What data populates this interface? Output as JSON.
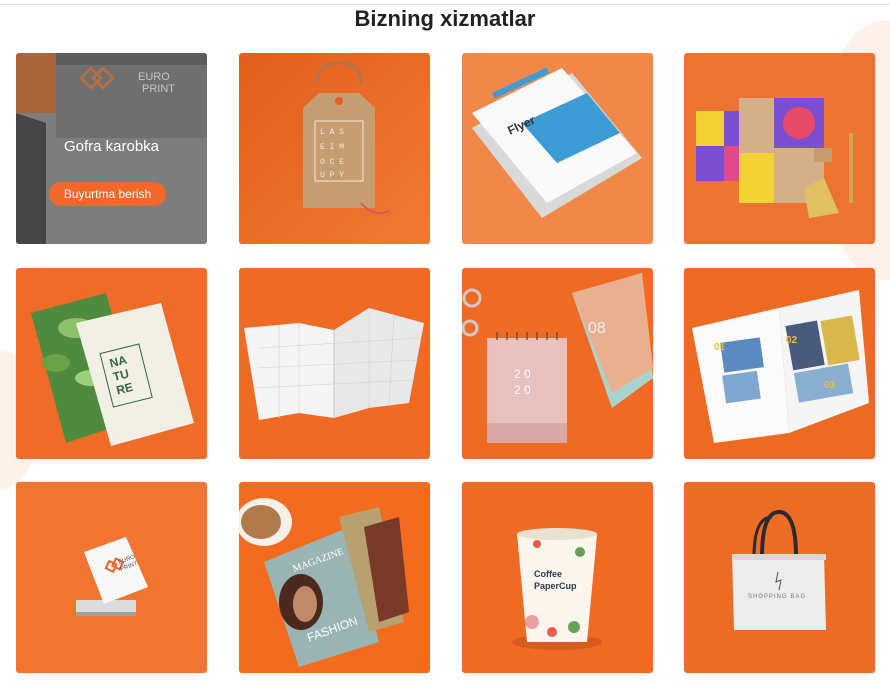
{
  "section": {
    "title": "Bizning xizmatlar"
  },
  "cards": [
    {
      "name": "Gofra karobka",
      "button_label": "Buyurtma berish",
      "logo_text": [
        "EURO",
        "PRINT"
      ]
    },
    {
      "tag_letters": "LASEIMOCEUPY"
    },
    {
      "flyer_title": "Flyer"
    },
    {},
    {
      "nature_text": [
        "NA",
        "TU",
        "RE"
      ]
    },
    {},
    {
      "calendar_year": [
        "2 0",
        "2 0"
      ],
      "calendar_month": "08"
    },
    {
      "magazine_numbers": [
        "01",
        "02",
        "03"
      ]
    },
    {
      "card_logo": [
        "EURO",
        "PRINT"
      ]
    },
    {
      "magazine_text": [
        "MAGAZINE",
        "FASHION"
      ]
    },
    {
      "cup_text": [
        "Coffee",
        "PaperCup"
      ]
    },
    {
      "bag_text": "SHOPPING BAG"
    }
  ],
  "colors": {
    "accent": "#f0682a",
    "tile_orange": "#ef6a22",
    "title": "#222222"
  }
}
